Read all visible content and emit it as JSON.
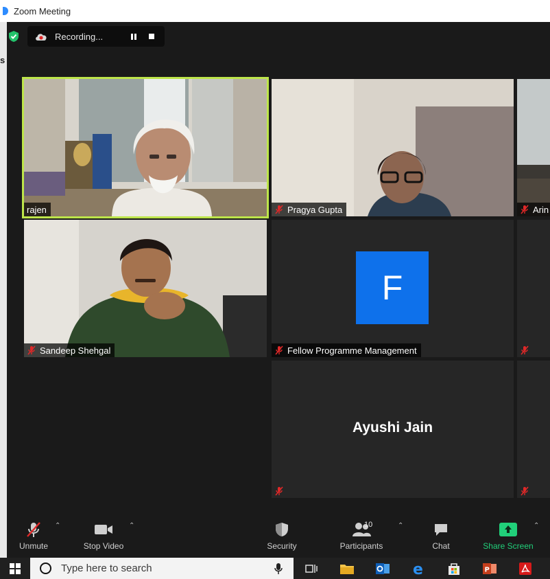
{
  "window": {
    "title": "Zoom Meeting"
  },
  "left_strip": {
    "text": "s"
  },
  "recording": {
    "label": "Recording..."
  },
  "participants": [
    {
      "name": "rajen"
    },
    {
      "name": "Pragya Gupta"
    },
    {
      "name": "Arin"
    },
    {
      "name": "Sandeep Shehgal"
    },
    {
      "name": "Fellow Programme Management",
      "initial": "F"
    },
    {
      "name": "Ayushi Jain"
    }
  ],
  "toolbar": {
    "unmute": "Unmute",
    "stop_video": "Stop Video",
    "security": "Security",
    "participants": "Participants",
    "participants_count": "10",
    "chat": "Chat",
    "share_screen": "Share Screen"
  },
  "taskbar": {
    "search_placeholder": "Type here to search"
  },
  "colors": {
    "active_speaker_border": "#bde54a",
    "share_green": "#21d07a",
    "avatar_blue": "#0e71eb",
    "mic_muted_red": "#e02828"
  }
}
